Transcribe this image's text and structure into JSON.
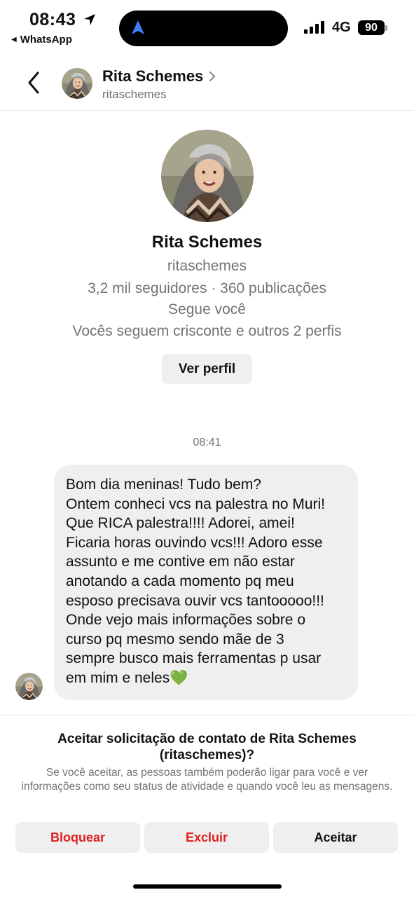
{
  "status_bar": {
    "time": "08:43",
    "back_app": "WhatsApp",
    "network": "4G",
    "battery": "90"
  },
  "header": {
    "name": "Rita Schemes",
    "username": "ritaschemes"
  },
  "profile": {
    "name": "Rita Schemes",
    "username": "ritaschemes",
    "stats": "3,2 mil seguidores · 360 publicações",
    "follows_you": "Segue você",
    "mutual": "Vocês seguem crisconte e outros 2 perfis",
    "view_button": "Ver perfil"
  },
  "conversation": {
    "timestamp": "08:41",
    "message_lines": [
      "Bom dia meninas! Tudo bem?",
      "Ontem conheci vcs na palestra no Muri!",
      "Que RICA palestra!!!! Adorei, amei!",
      "Ficaria horas ouvindo vcs!!! Adoro esse",
      "assunto e me contive em não estar",
      "anotando a cada momento pq meu",
      "esposo precisava ouvir vcs tantooooo!!!",
      "Onde vejo mais informações sobre o",
      "curso pq mesmo sendo mãe de 3",
      "sempre busco mais ferramentas p usar",
      "em mim e neles"
    ],
    "emoji": "💚"
  },
  "request": {
    "title": "Aceitar solicitação de contato de Rita Schemes (ritaschemes)?",
    "description": "Se você aceitar, as pessoas também poderão ligar para você e ver informações como seu status de atividade e quando você leu as mensagens.",
    "block_label": "Bloquear",
    "delete_label": "Excluir",
    "accept_label": "Aceitar"
  },
  "colors": {
    "danger": "#e0201f",
    "secondary_text": "#737373",
    "bubble": "#efefef"
  }
}
